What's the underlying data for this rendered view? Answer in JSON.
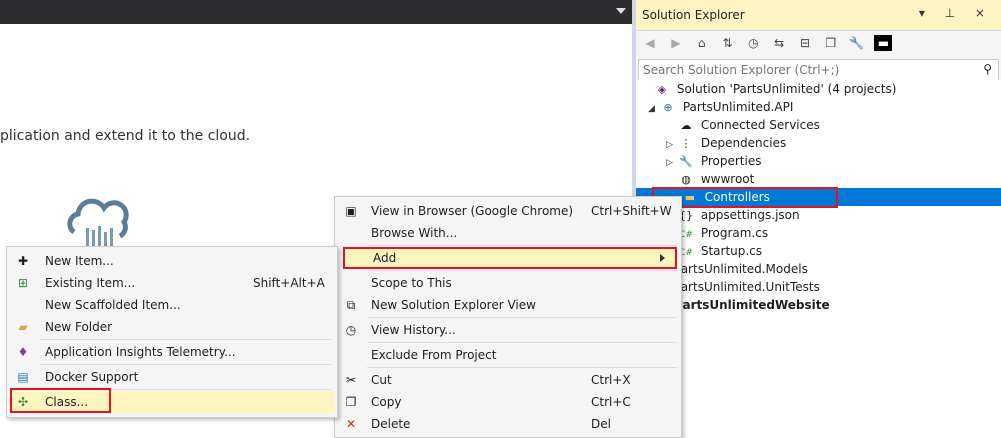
{
  "doc": {
    "intro_text": "plication and extend it to the cloud."
  },
  "solution_explorer": {
    "title": "Solution Explorer",
    "title_controls": "▾ ⊥ ×",
    "search_placeholder": "Search Solution Explorer (Ctrl+;)",
    "tree": [
      {
        "label": "Solution 'PartsUnlimited' (4 projects)",
        "icon": "solution-icon"
      },
      {
        "label": "PartsUnlimited.API",
        "icon": "web-project-icon"
      },
      {
        "label": "Connected Services",
        "icon": "connected-services-icon"
      },
      {
        "label": "Dependencies",
        "icon": "dependencies-icon"
      },
      {
        "label": "Properties",
        "icon": "wrench-icon"
      },
      {
        "label": "wwwroot",
        "icon": "globe-icon"
      },
      {
        "label": "Controllers",
        "icon": "folder-icon"
      },
      {
        "label": "appsettings.json",
        "icon": "json-icon"
      },
      {
        "label": "Program.cs",
        "icon": "csharp-icon"
      },
      {
        "label": "Startup.cs",
        "icon": "csharp-icon"
      },
      {
        "label": "PartsUnlimited.Models",
        "icon": "project-icon"
      },
      {
        "label": "PartsUnlimited.UnitTests",
        "icon": "project-icon"
      },
      {
        "label": "PartsUnlimitedWebsite",
        "icon": "project-icon"
      }
    ],
    "cs_glyph": "C#"
  },
  "context_menu": {
    "items": [
      {
        "label": "View in Browser (Google Chrome)",
        "shortcut": "Ctrl+Shift+W",
        "icon": "browser-icon"
      },
      {
        "label": "Browse With...",
        "shortcut": "",
        "icon": ""
      },
      {
        "label": "Add",
        "shortcut": "",
        "icon": ""
      },
      {
        "label": "Scope to This",
        "shortcut": "",
        "icon": ""
      },
      {
        "label": "New Solution Explorer View",
        "shortcut": "",
        "icon": "new-view-icon"
      },
      {
        "label": "View History...",
        "shortcut": "",
        "icon": "history-icon"
      },
      {
        "label": "Exclude From Project",
        "shortcut": "",
        "icon": ""
      },
      {
        "label": "Cut",
        "shortcut": "Ctrl+X",
        "icon": "scissors-icon"
      },
      {
        "label": "Copy",
        "shortcut": "Ctrl+C",
        "icon": "copy-icon"
      },
      {
        "label": "Delete",
        "shortcut": "Del",
        "icon": "delete-icon"
      }
    ]
  },
  "add_submenu": {
    "items": [
      {
        "label": "New Item...",
        "shortcut": "",
        "icon": "new-item-icon"
      },
      {
        "label": "Existing Item...",
        "shortcut": "Shift+Alt+A",
        "icon": "existing-item-icon"
      },
      {
        "label": "New Scaffolded Item...",
        "shortcut": "",
        "icon": ""
      },
      {
        "label": "New Folder",
        "shortcut": "",
        "icon": "new-folder-icon"
      },
      {
        "label": "Application Insights Telemetry...",
        "shortcut": "",
        "icon": "app-insights-icon"
      },
      {
        "label": "Docker Support",
        "shortcut": "",
        "icon": "docker-icon"
      },
      {
        "label": "Class...",
        "shortcut": "",
        "icon": "class-icon"
      }
    ]
  },
  "colors": {
    "selection": "#0078d7",
    "highlight": "#fdf4bf",
    "annotation_box": "#e81123",
    "title_bar": "#2d2d30"
  }
}
